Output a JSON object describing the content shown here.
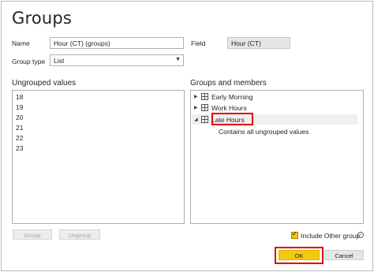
{
  "dialog": {
    "title": "Groups",
    "name_label": "Name",
    "name_value": "Hour (CT) (groups)",
    "field_label": "Field",
    "field_value": "Hour (CT)",
    "group_type_label": "Group type",
    "group_type_value": "List"
  },
  "ungrouped": {
    "title": "Ungrouped values",
    "values": [
      "18",
      "19",
      "20",
      "21",
      "22",
      "23"
    ]
  },
  "groups": {
    "title": "Groups and members",
    "items": [
      {
        "label": "Early Morning",
        "expand": "▶"
      },
      {
        "label": "Work Hours",
        "expand": "▶"
      },
      {
        "label": "Late Hours",
        "expand": "◢"
      }
    ],
    "sub_text": "Contains all ungrouped values"
  },
  "buttons": {
    "group": "Group",
    "ungroup": "Ungroup",
    "ok": "OK",
    "cancel": "Cancel"
  },
  "options": {
    "include_other_label": "Include Other group",
    "include_other_checked": true,
    "info_glyph": "i"
  },
  "colors": {
    "accent": "#f2c811",
    "highlight": "#e00000"
  }
}
